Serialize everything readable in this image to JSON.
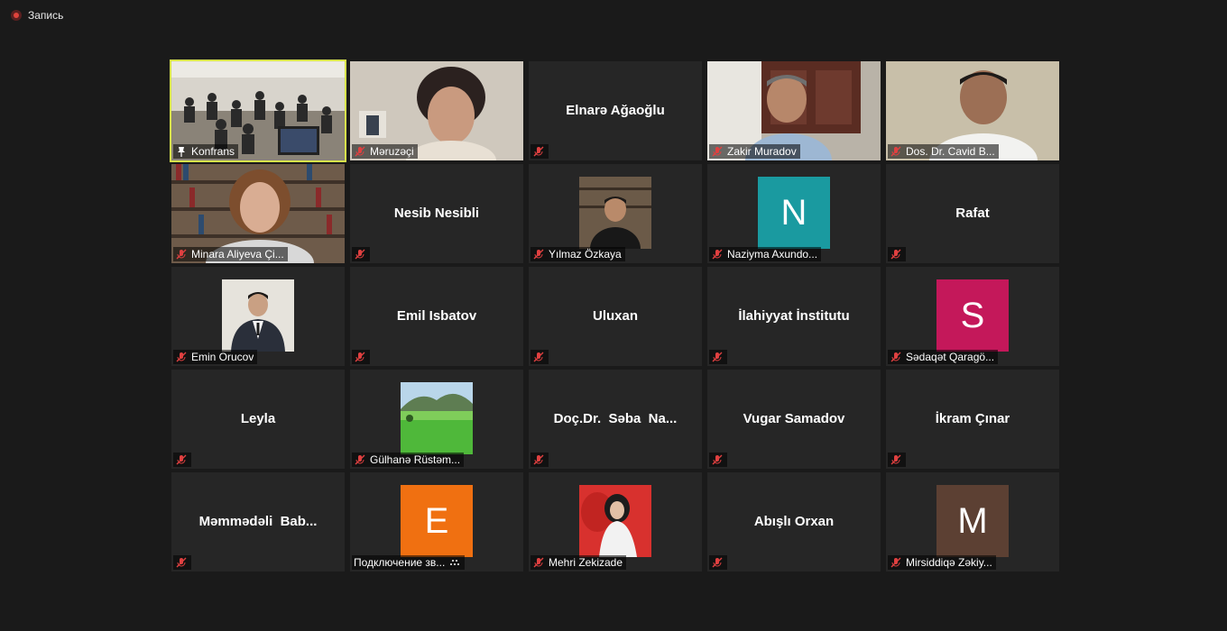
{
  "recording": {
    "label": "Запись"
  },
  "colors": {
    "background": "#1a1a1a",
    "tile": "#262626",
    "active_speaker": "#d7e34b",
    "mute_icon": "#e04040",
    "avatar_n": "#1a9aa0",
    "avatar_s": "#c4185a",
    "avatar_e": "#f07011",
    "avatar_m": "#5c4033"
  },
  "participants": [
    {
      "name": "Konfrans",
      "display": "video",
      "icon": "pin-icon",
      "active": true
    },
    {
      "name": "Məruzəçi",
      "display": "video",
      "icon": "mic-muted-icon"
    },
    {
      "name": "Elnarə Ağaoğlu",
      "display": "name",
      "icon": "mic-muted-icon"
    },
    {
      "name": "Zakir Muradov",
      "display": "video",
      "icon": "mic-muted-icon"
    },
    {
      "name": "Dos. Dr. Cavid B...",
      "display": "video",
      "icon": "mic-muted-icon"
    },
    {
      "name": "Minara Aliyeva Çi...",
      "display": "video",
      "icon": "mic-muted-icon"
    },
    {
      "name": "Nesib Nesibli",
      "display": "name",
      "icon": "mic-muted-icon"
    },
    {
      "name": "Yılmaz Özkaya",
      "display": "photo",
      "icon": "mic-muted-icon"
    },
    {
      "name": "Naziyma Axundo...",
      "display": "avatar",
      "initial": "N",
      "icon": "mic-muted-icon"
    },
    {
      "name": "Rafat",
      "display": "name",
      "icon": "mic-muted-icon"
    },
    {
      "name": "Emin Orucov",
      "display": "photo",
      "icon": "mic-muted-icon"
    },
    {
      "name": "Emil Isbatov",
      "display": "name",
      "icon": "mic-muted-icon"
    },
    {
      "name": "Uluxan",
      "display": "name",
      "icon": "mic-muted-icon"
    },
    {
      "name": "İlahiyyat İnstitutu",
      "display": "name",
      "icon": "mic-muted-icon"
    },
    {
      "name": "Sədaqət Qaragö...",
      "display": "avatar",
      "initial": "S",
      "icon": "mic-muted-icon"
    },
    {
      "name": "Leyla",
      "display": "name",
      "icon": "mic-muted-icon"
    },
    {
      "name": "Gülhanə Rüstəm...",
      "display": "photo",
      "icon": "mic-muted-icon"
    },
    {
      "name": "Doç.Dr.  Səba  Na...",
      "display": "name",
      "icon": "mic-muted-icon"
    },
    {
      "name": "Vugar Samadov",
      "display": "name",
      "icon": "mic-muted-icon"
    },
    {
      "name": "İkram Çınar",
      "display": "name",
      "icon": "mic-muted-icon"
    },
    {
      "name": "Məmmədəli  Bab...",
      "display": "name",
      "icon": "mic-muted-icon"
    },
    {
      "name": "Подключение зв...",
      "display": "avatar",
      "initial": "E",
      "icon": "phone-connecting-icon"
    },
    {
      "name": "Mehri Zekizade",
      "display": "photo",
      "icon": "mic-muted-icon"
    },
    {
      "name": "Abışlı Orxan",
      "display": "name",
      "icon": "mic-muted-icon"
    },
    {
      "name": "Mirsiddiqə Zəkiy...",
      "display": "avatar",
      "initial": "M",
      "icon": "mic-muted-icon"
    }
  ]
}
